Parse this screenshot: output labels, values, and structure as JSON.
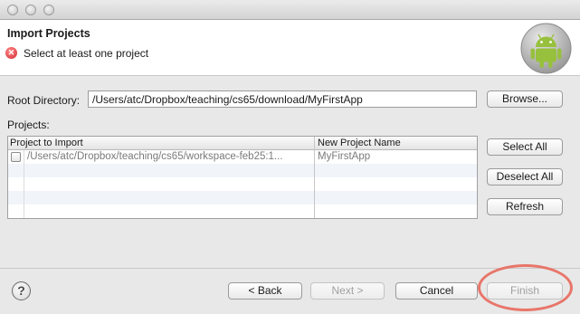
{
  "dialog": {
    "title": "Import Projects",
    "message": "Select at least one project"
  },
  "root_directory": {
    "label": "Root Directory:",
    "value": "/Users/atc/Dropbox/teaching/cs65/download/MyFirstApp",
    "browse_label": "Browse..."
  },
  "projects": {
    "label": "Projects:",
    "columns": [
      "Project to Import",
      "New Project Name"
    ],
    "rows": [
      {
        "checked": false,
        "path": "/Users/atc/Dropbox/teaching/cs65/workspace-feb25:1...",
        "name": "MyFirstApp"
      }
    ]
  },
  "side_buttons": {
    "select_all": "Select All",
    "deselect_all": "Deselect All",
    "refresh": "Refresh"
  },
  "footer": {
    "back": "< Back",
    "next": "Next >",
    "cancel": "Cancel",
    "finish": "Finish",
    "help_glyph": "?"
  },
  "colors": {
    "error": "#d3262b",
    "highlight_ring": "#e8766a",
    "android_green": "#97c03d"
  }
}
